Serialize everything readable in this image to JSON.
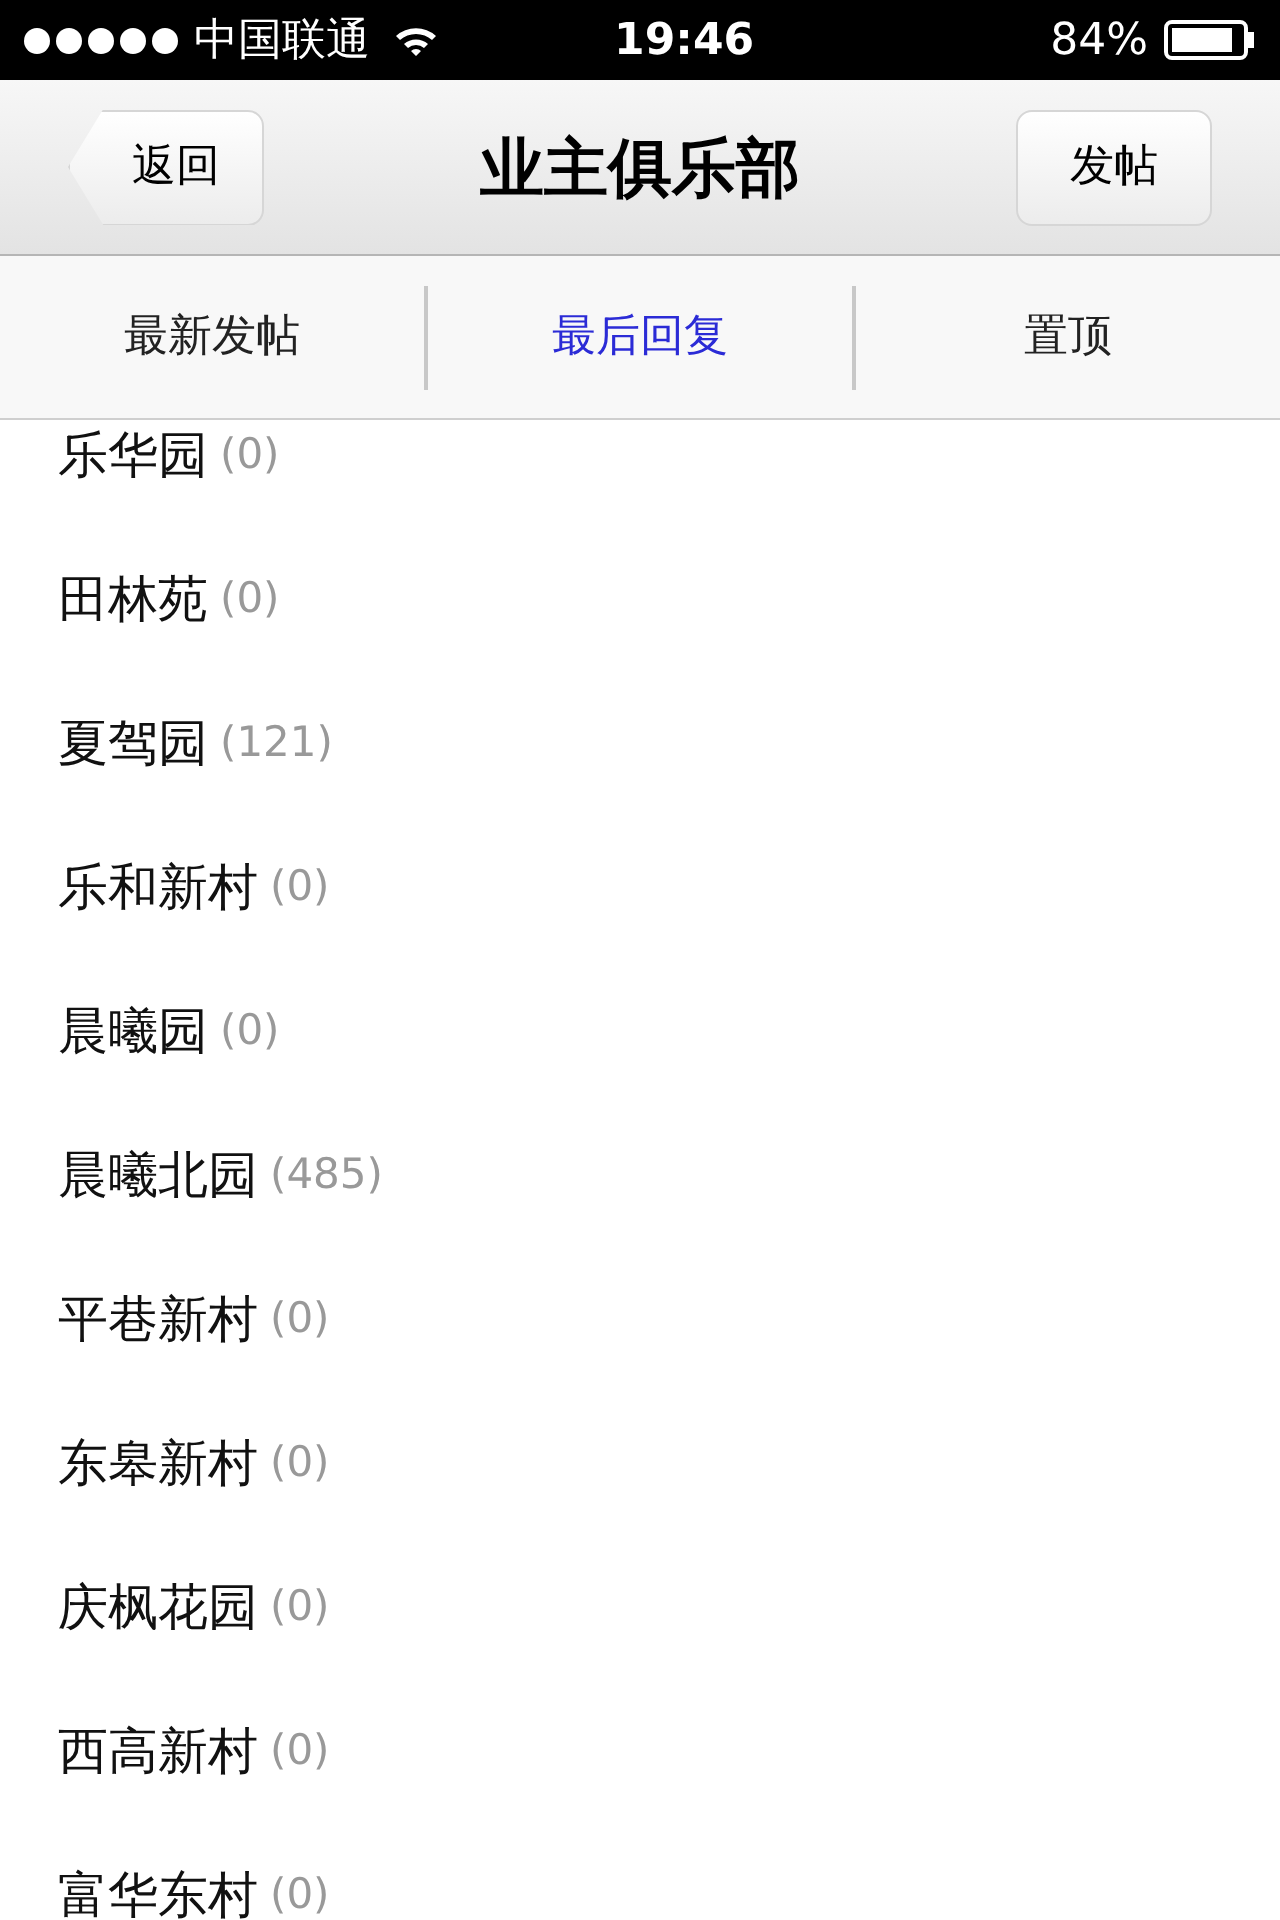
{
  "status_bar": {
    "carrier": "中国联通",
    "time": "19:46",
    "battery": "84%"
  },
  "nav_bar": {
    "back": "返回",
    "title": "业主俱乐部",
    "action": "发帖"
  },
  "tabs": [
    {
      "label": "最新发帖",
      "selected": false
    },
    {
      "label": "最后回复",
      "selected": true
    },
    {
      "label": "置顶",
      "selected": false
    }
  ],
  "items": [
    {
      "name": "乐华园",
      "count": "(0)"
    },
    {
      "name": "田林苑",
      "count": "(0)"
    },
    {
      "name": "夏驾园",
      "count": "(121)"
    },
    {
      "name": "乐和新村",
      "count": "(0)"
    },
    {
      "name": "晨曦园",
      "count": "(0)"
    },
    {
      "name": "晨曦北园",
      "count": "(485)"
    },
    {
      "name": "平巷新村",
      "count": "(0)"
    },
    {
      "name": "东皋新村",
      "count": "(0)"
    },
    {
      "name": "庆枫花园",
      "count": "(0)"
    },
    {
      "name": "西高新村",
      "count": "(0)"
    },
    {
      "name": "富华东村",
      "count": "(0)"
    }
  ]
}
